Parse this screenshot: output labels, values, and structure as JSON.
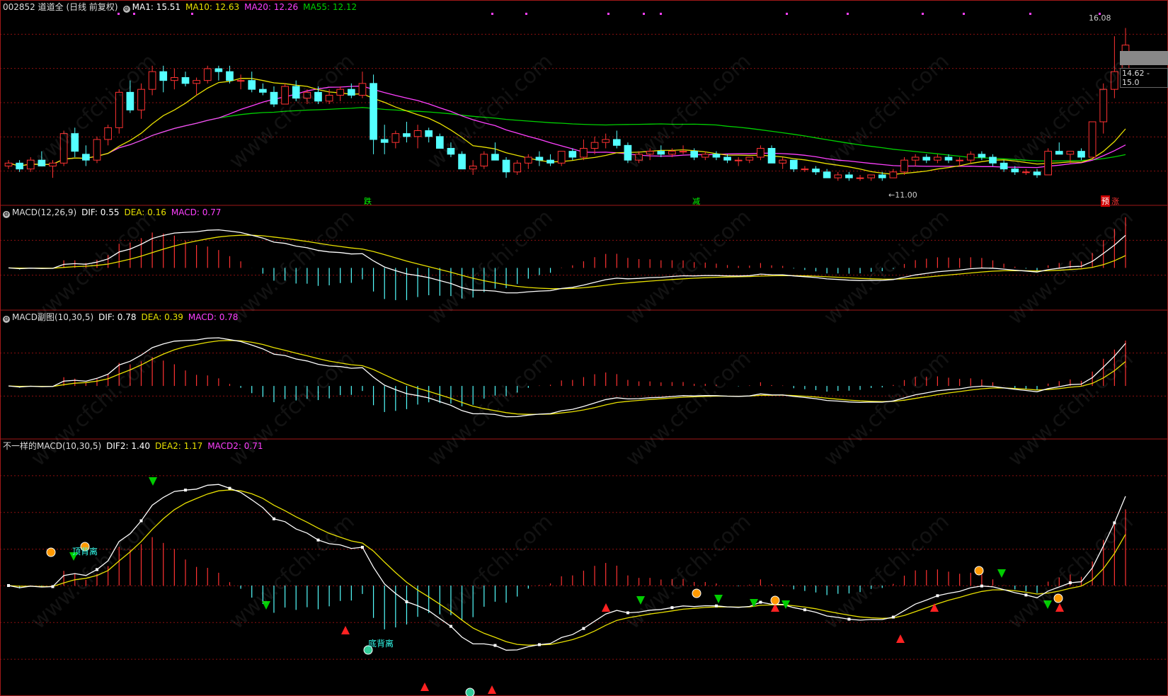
{
  "stock": {
    "header_title": "002852 道道全 (日线 前复权)",
    "ma1": "MA1: 15.51",
    "ma10": "MA10: 12.63",
    "ma20": "MA20: 12.26",
    "ma55": "MA55: 12.12"
  },
  "macd1": {
    "title": "MACD(12,26,9)",
    "dif": "DIF: 0.55",
    "dea": "DEA: 0.16",
    "macd": "MACD: 0.77"
  },
  "macd2": {
    "title": "MACD副图(10,30,5)",
    "dif": "DIF: 0.78",
    "dea": "DEA: 0.39",
    "macd": "MACD: 0.78"
  },
  "macd3": {
    "title": "不一样的MACD(10,30,5)",
    "dif": "DIF2: 1.40",
    "dea": "DEA2: 1.17",
    "macd": "MACD2: 0.71"
  },
  "markers": {
    "high": "16.08",
    "low": "←11.00",
    "fall": "跌",
    "reduce": "减",
    "forecast": "预",
    "rise": "涨",
    "price_range": "14.62 - 15.0",
    "divergence_top": "顶背离",
    "divergence_bottom": "底背离"
  },
  "watermark": "www.cfchi.com",
  "colors": {
    "up": "#ff3232",
    "down": "#54ffff",
    "ma1": "#ffffff",
    "ma10": "#e8e000",
    "ma20": "#ff40ff",
    "ma55": "#00d000",
    "grid": "#8b1010"
  },
  "chart_data": {
    "type": "candlestick",
    "price_ylim": [
      10.5,
      16.5
    ],
    "candles_ohlc": [
      [
        11.4,
        11.6,
        11.3,
        11.5
      ],
      [
        11.5,
        11.6,
        11.2,
        11.3
      ],
      [
        11.3,
        11.7,
        11.2,
        11.6
      ],
      [
        11.6,
        11.9,
        11.4,
        11.4
      ],
      [
        11.4,
        11.6,
        11.0,
        11.5
      ],
      [
        11.5,
        12.6,
        11.4,
        12.5
      ],
      [
        12.5,
        12.7,
        11.7,
        11.9
      ],
      [
        11.8,
        12.1,
        11.4,
        11.6
      ],
      [
        11.6,
        12.4,
        11.5,
        12.3
      ],
      [
        12.3,
        12.8,
        12.1,
        12.7
      ],
      [
        12.7,
        14.0,
        12.5,
        13.9
      ],
      [
        13.9,
        14.3,
        13.2,
        13.3
      ],
      [
        13.3,
        14.2,
        13.0,
        14.0
      ],
      [
        14.0,
        14.8,
        13.8,
        14.6
      ],
      [
        14.6,
        14.8,
        13.9,
        14.3
      ],
      [
        14.3,
        14.7,
        14.0,
        14.4
      ],
      [
        14.4,
        14.6,
        14.1,
        14.2
      ],
      [
        14.2,
        14.4,
        13.8,
        14.3
      ],
      [
        14.3,
        14.8,
        14.2,
        14.7
      ],
      [
        14.7,
        14.8,
        14.3,
        14.6
      ],
      [
        14.6,
        14.8,
        14.2,
        14.3
      ],
      [
        14.3,
        14.5,
        14.0,
        14.3
      ],
      [
        14.3,
        14.6,
        13.9,
        14.0
      ],
      [
        14.0,
        14.2,
        13.8,
        13.9
      ],
      [
        13.9,
        14.1,
        13.4,
        13.5
      ],
      [
        13.5,
        14.2,
        13.5,
        14.1
      ],
      [
        14.1,
        14.3,
        13.6,
        13.7
      ],
      [
        13.7,
        14.0,
        13.5,
        13.9
      ],
      [
        13.9,
        14.1,
        13.5,
        13.6
      ],
      [
        13.6,
        14.0,
        13.5,
        13.8
      ],
      [
        13.8,
        14.1,
        13.6,
        14.0
      ],
      [
        14.0,
        14.2,
        13.7,
        13.8
      ],
      [
        13.8,
        14.6,
        13.7,
        14.2
      ],
      [
        14.2,
        14.5,
        11.8,
        12.3
      ],
      [
        12.3,
        12.8,
        11.8,
        12.2
      ],
      [
        12.2,
        12.6,
        12.0,
        12.5
      ],
      [
        12.5,
        12.9,
        12.2,
        12.4
      ],
      [
        12.4,
        12.8,
        12.0,
        12.6
      ],
      [
        12.6,
        12.7,
        12.2,
        12.4
      ],
      [
        12.4,
        12.5,
        12.0,
        12.0
      ],
      [
        12.0,
        12.2,
        11.7,
        11.8
      ],
      [
        11.8,
        11.9,
        11.3,
        11.3
      ],
      [
        11.3,
        11.6,
        11.1,
        11.4
      ],
      [
        11.4,
        11.9,
        11.3,
        11.8
      ],
      [
        11.8,
        12.2,
        11.6,
        11.6
      ],
      [
        11.6,
        11.7,
        11.0,
        11.2
      ],
      [
        11.2,
        11.6,
        11.1,
        11.5
      ],
      [
        11.5,
        11.8,
        11.3,
        11.7
      ],
      [
        11.7,
        11.9,
        11.4,
        11.6
      ],
      [
        11.6,
        11.8,
        11.4,
        11.5
      ],
      [
        11.5,
        11.9,
        11.4,
        11.9
      ],
      [
        11.9,
        12.0,
        11.6,
        11.7
      ],
      [
        11.7,
        12.3,
        11.6,
        12.0
      ],
      [
        12.0,
        12.4,
        11.8,
        12.2
      ],
      [
        12.2,
        12.5,
        12.0,
        12.3
      ],
      [
        12.3,
        12.6,
        12.0,
        12.1
      ],
      [
        12.1,
        12.2,
        11.5,
        11.6
      ],
      [
        11.6,
        11.9,
        11.5,
        11.8
      ],
      [
        11.8,
        12.0,
        11.6,
        11.9
      ],
      [
        11.9,
        12.1,
        11.7,
        11.8
      ],
      [
        11.8,
        12.0,
        11.7,
        11.9
      ],
      [
        11.9,
        12.1,
        11.8,
        11.9
      ],
      [
        11.9,
        12.0,
        11.6,
        11.7
      ],
      [
        11.7,
        11.9,
        11.6,
        11.8
      ],
      [
        11.8,
        11.9,
        11.6,
        11.7
      ],
      [
        11.7,
        11.8,
        11.5,
        11.6
      ],
      [
        11.6,
        11.7,
        11.4,
        11.6
      ],
      [
        11.6,
        11.7,
        11.5,
        11.7
      ],
      [
        11.7,
        12.1,
        11.6,
        12.0
      ],
      [
        12.0,
        12.1,
        11.5,
        11.5
      ],
      [
        11.5,
        11.7,
        11.3,
        11.6
      ],
      [
        11.6,
        11.6,
        11.2,
        11.3
      ],
      [
        11.3,
        11.4,
        11.2,
        11.3
      ],
      [
        11.3,
        11.4,
        11.1,
        11.2
      ],
      [
        11.2,
        11.3,
        11.0,
        11.0
      ],
      [
        11.0,
        11.2,
        10.9,
        11.1
      ],
      [
        11.1,
        11.2,
        10.9,
        11.0
      ],
      [
        11.0,
        11.1,
        10.9,
        11.0
      ],
      [
        11.0,
        11.1,
        10.9,
        11.1
      ],
      [
        11.1,
        11.2,
        10.9,
        11.0
      ],
      [
        11.0,
        11.3,
        11.0,
        11.2
      ],
      [
        11.2,
        11.7,
        11.1,
        11.6
      ],
      [
        11.6,
        11.8,
        11.4,
        11.7
      ],
      [
        11.7,
        11.8,
        11.5,
        11.6
      ],
      [
        11.6,
        11.8,
        11.5,
        11.7
      ],
      [
        11.7,
        11.8,
        11.5,
        11.6
      ],
      [
        11.6,
        11.7,
        11.4,
        11.6
      ],
      [
        11.6,
        11.9,
        11.5,
        11.8
      ],
      [
        11.8,
        11.9,
        11.6,
        11.7
      ],
      [
        11.7,
        11.8,
        11.4,
        11.5
      ],
      [
        11.5,
        11.6,
        11.2,
        11.3
      ],
      [
        11.3,
        11.4,
        11.1,
        11.2
      ],
      [
        11.2,
        11.3,
        11.1,
        11.2
      ],
      [
        11.2,
        11.3,
        11.0,
        11.1
      ],
      [
        11.1,
        12.0,
        11.1,
        11.9
      ],
      [
        11.9,
        12.2,
        11.8,
        11.8
      ],
      [
        11.8,
        11.9,
        11.5,
        11.9
      ],
      [
        11.9,
        12.0,
        11.6,
        11.7
      ],
      [
        11.7,
        12.9,
        11.7,
        12.9
      ],
      [
        12.9,
        14.2,
        12.5,
        14.0
      ],
      [
        14.0,
        15.8,
        13.7,
        14.6
      ],
      [
        14.6,
        16.08,
        14.5,
        15.5
      ]
    ]
  }
}
